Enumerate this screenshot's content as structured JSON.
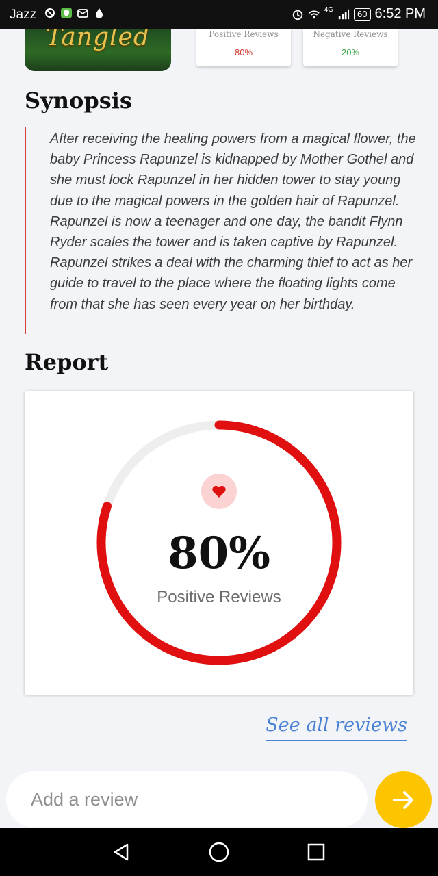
{
  "status_bar": {
    "carrier": "Jazz",
    "network_type": "4G",
    "battery": "60",
    "time": "6:52 PM"
  },
  "movie": {
    "poster_title": "Tangled"
  },
  "review_cards": {
    "positive": {
      "label": "Positive Reviews",
      "value": "80%",
      "color": "#d23a32"
    },
    "negative": {
      "label": "Negative Reviews",
      "value": "20%",
      "color": "#3aa34a"
    }
  },
  "synopsis": {
    "title": "Synopsis",
    "text": "After receiving the healing powers from a magical flower, the baby Princess Rapunzel is kidnapped by Mother Gothel and she must lock Rapunzel in her hidden tower to stay young due to the magical powers in the golden hair of Rapunzel. Rapunzel is now a teenager and one day, the bandit Flynn Ryder scales the tower and is taken captive by Rapunzel. Rapunzel strikes a deal with the charming thief to act as her guide to travel to the place where the floating lights come from that she has seen every year on her birthday."
  },
  "report": {
    "title": "Report",
    "percent_text": "80%",
    "percent_value": 0.8,
    "label": "Positive Reviews",
    "gauge_color": "#e01010",
    "track_color": "#eeeeee",
    "icon": "heart-icon"
  },
  "see_all_label": "See all reviews",
  "review_input": {
    "placeholder": "Add a review"
  },
  "colors": {
    "accent_yellow": "#fdc500",
    "link_blue": "#4a83d6"
  }
}
